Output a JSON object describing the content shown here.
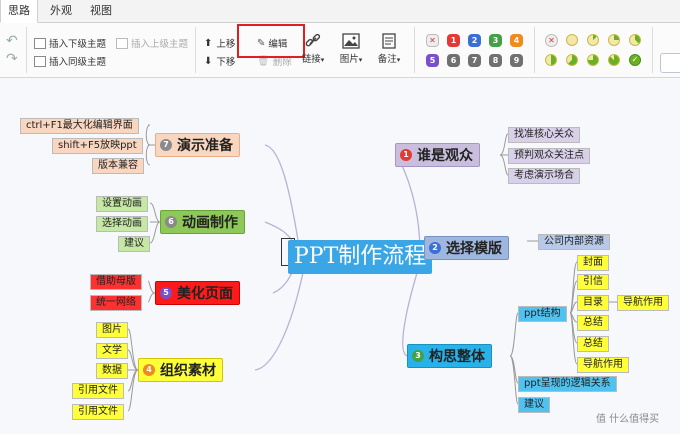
{
  "tabs": [
    "思路",
    "外观",
    "视图"
  ],
  "ribbon": {
    "insert_child": "插入下级主题",
    "insert_parent": "插入上级主题",
    "insert_sibling": "插入同级主题",
    "move_up": "上移",
    "move_down": "下移",
    "edit": "编辑",
    "delete": "删除",
    "link": "链接",
    "image": "图片",
    "note": "备注",
    "priority_labels": [
      "1",
      "2",
      "3",
      "4",
      "5",
      "6",
      "7",
      "8",
      "9"
    ],
    "priority_colors": [
      "#e53935",
      "#3b6fd8",
      "#43a047",
      "#f08a1c",
      "#7b4fc9",
      "#707070",
      "#707070",
      "#707070",
      "#707070"
    ]
  },
  "mindmap": {
    "center": "PPT制作流程",
    "branches": [
      {
        "label": "演示准备",
        "badge": "7",
        "badge_color": "#8a8a8a",
        "color": "#f9d6bf",
        "children": [
          "ctrl+F1最大化编辑界面",
          "shift+F5放映ppt",
          "版本兼容"
        ]
      },
      {
        "label": "动画制作",
        "badge": "6",
        "badge_color": "#8a8a8a",
        "color": "#8dc858",
        "children": [
          "设置动画",
          "选择动画",
          "建议"
        ]
      },
      {
        "label": "美化页面",
        "badge": "5",
        "badge_color": "#7b4fc9",
        "color": "#ff1a1a",
        "children": [
          "借助母版",
          "统一网络"
        ]
      },
      {
        "label": "组织素材",
        "badge": "4",
        "badge_color": "#f08a1c",
        "color": "#ffff3a",
        "children": [
          "图片",
          "文学",
          "数据",
          "引用文件",
          "引用文件"
        ]
      },
      {
        "label": "谁是观众",
        "badge": "1",
        "badge_color": "#e53935",
        "color": "#c9bfdd",
        "children": [
          "找准核心关众",
          "预判观众关注点",
          "考虑演示场合"
        ]
      },
      {
        "label": "选择模版",
        "badge": "2",
        "badge_color": "#3b6fd8",
        "color": "#9fb6de",
        "children": [
          "公司内部资源"
        ]
      },
      {
        "label": "构思整体",
        "badge": "3",
        "badge_color": "#43a047",
        "color": "#27b3ea",
        "children": [
          "ppt结构",
          "ppt呈现的逻辑关系",
          "建议"
        ]
      }
    ],
    "ppt_structure_children": [
      "封面",
      "引信",
      "目录",
      "总结",
      "总结",
      "导航作用"
    ],
    "nav_note": "导航作用"
  },
  "watermark": "值 什么值得买"
}
